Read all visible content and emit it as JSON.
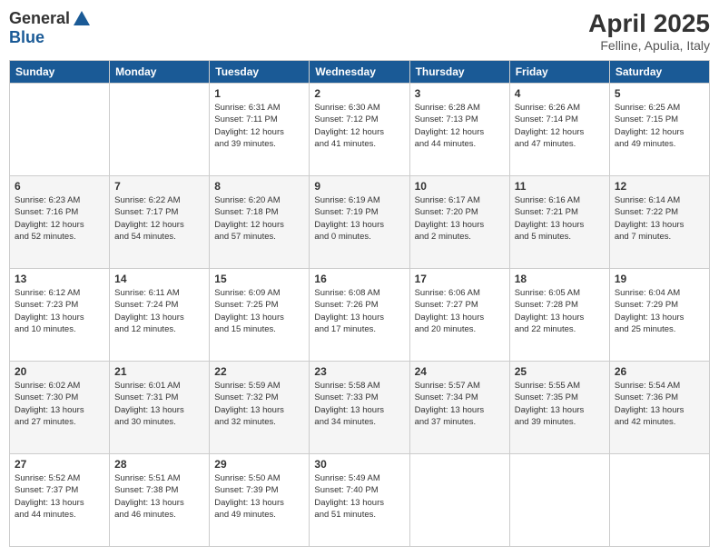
{
  "header": {
    "logo_general": "General",
    "logo_blue": "Blue",
    "month_title": "April 2025",
    "location": "Felline, Apulia, Italy"
  },
  "weekdays": [
    "Sunday",
    "Monday",
    "Tuesday",
    "Wednesday",
    "Thursday",
    "Friday",
    "Saturday"
  ],
  "rows": [
    [
      {
        "day": "",
        "text": ""
      },
      {
        "day": "",
        "text": ""
      },
      {
        "day": "1",
        "text": "Sunrise: 6:31 AM\nSunset: 7:11 PM\nDaylight: 12 hours\nand 39 minutes."
      },
      {
        "day": "2",
        "text": "Sunrise: 6:30 AM\nSunset: 7:12 PM\nDaylight: 12 hours\nand 41 minutes."
      },
      {
        "day": "3",
        "text": "Sunrise: 6:28 AM\nSunset: 7:13 PM\nDaylight: 12 hours\nand 44 minutes."
      },
      {
        "day": "4",
        "text": "Sunrise: 6:26 AM\nSunset: 7:14 PM\nDaylight: 12 hours\nand 47 minutes."
      },
      {
        "day": "5",
        "text": "Sunrise: 6:25 AM\nSunset: 7:15 PM\nDaylight: 12 hours\nand 49 minutes."
      }
    ],
    [
      {
        "day": "6",
        "text": "Sunrise: 6:23 AM\nSunset: 7:16 PM\nDaylight: 12 hours\nand 52 minutes."
      },
      {
        "day": "7",
        "text": "Sunrise: 6:22 AM\nSunset: 7:17 PM\nDaylight: 12 hours\nand 54 minutes."
      },
      {
        "day": "8",
        "text": "Sunrise: 6:20 AM\nSunset: 7:18 PM\nDaylight: 12 hours\nand 57 minutes."
      },
      {
        "day": "9",
        "text": "Sunrise: 6:19 AM\nSunset: 7:19 PM\nDaylight: 13 hours\nand 0 minutes."
      },
      {
        "day": "10",
        "text": "Sunrise: 6:17 AM\nSunset: 7:20 PM\nDaylight: 13 hours\nand 2 minutes."
      },
      {
        "day": "11",
        "text": "Sunrise: 6:16 AM\nSunset: 7:21 PM\nDaylight: 13 hours\nand 5 minutes."
      },
      {
        "day": "12",
        "text": "Sunrise: 6:14 AM\nSunset: 7:22 PM\nDaylight: 13 hours\nand 7 minutes."
      }
    ],
    [
      {
        "day": "13",
        "text": "Sunrise: 6:12 AM\nSunset: 7:23 PM\nDaylight: 13 hours\nand 10 minutes."
      },
      {
        "day": "14",
        "text": "Sunrise: 6:11 AM\nSunset: 7:24 PM\nDaylight: 13 hours\nand 12 minutes."
      },
      {
        "day": "15",
        "text": "Sunrise: 6:09 AM\nSunset: 7:25 PM\nDaylight: 13 hours\nand 15 minutes."
      },
      {
        "day": "16",
        "text": "Sunrise: 6:08 AM\nSunset: 7:26 PM\nDaylight: 13 hours\nand 17 minutes."
      },
      {
        "day": "17",
        "text": "Sunrise: 6:06 AM\nSunset: 7:27 PM\nDaylight: 13 hours\nand 20 minutes."
      },
      {
        "day": "18",
        "text": "Sunrise: 6:05 AM\nSunset: 7:28 PM\nDaylight: 13 hours\nand 22 minutes."
      },
      {
        "day": "19",
        "text": "Sunrise: 6:04 AM\nSunset: 7:29 PM\nDaylight: 13 hours\nand 25 minutes."
      }
    ],
    [
      {
        "day": "20",
        "text": "Sunrise: 6:02 AM\nSunset: 7:30 PM\nDaylight: 13 hours\nand 27 minutes."
      },
      {
        "day": "21",
        "text": "Sunrise: 6:01 AM\nSunset: 7:31 PM\nDaylight: 13 hours\nand 30 minutes."
      },
      {
        "day": "22",
        "text": "Sunrise: 5:59 AM\nSunset: 7:32 PM\nDaylight: 13 hours\nand 32 minutes."
      },
      {
        "day": "23",
        "text": "Sunrise: 5:58 AM\nSunset: 7:33 PM\nDaylight: 13 hours\nand 34 minutes."
      },
      {
        "day": "24",
        "text": "Sunrise: 5:57 AM\nSunset: 7:34 PM\nDaylight: 13 hours\nand 37 minutes."
      },
      {
        "day": "25",
        "text": "Sunrise: 5:55 AM\nSunset: 7:35 PM\nDaylight: 13 hours\nand 39 minutes."
      },
      {
        "day": "26",
        "text": "Sunrise: 5:54 AM\nSunset: 7:36 PM\nDaylight: 13 hours\nand 42 minutes."
      }
    ],
    [
      {
        "day": "27",
        "text": "Sunrise: 5:52 AM\nSunset: 7:37 PM\nDaylight: 13 hours\nand 44 minutes."
      },
      {
        "day": "28",
        "text": "Sunrise: 5:51 AM\nSunset: 7:38 PM\nDaylight: 13 hours\nand 46 minutes."
      },
      {
        "day": "29",
        "text": "Sunrise: 5:50 AM\nSunset: 7:39 PM\nDaylight: 13 hours\nand 49 minutes."
      },
      {
        "day": "30",
        "text": "Sunrise: 5:49 AM\nSunset: 7:40 PM\nDaylight: 13 hours\nand 51 minutes."
      },
      {
        "day": "",
        "text": ""
      },
      {
        "day": "",
        "text": ""
      },
      {
        "day": "",
        "text": ""
      }
    ]
  ]
}
